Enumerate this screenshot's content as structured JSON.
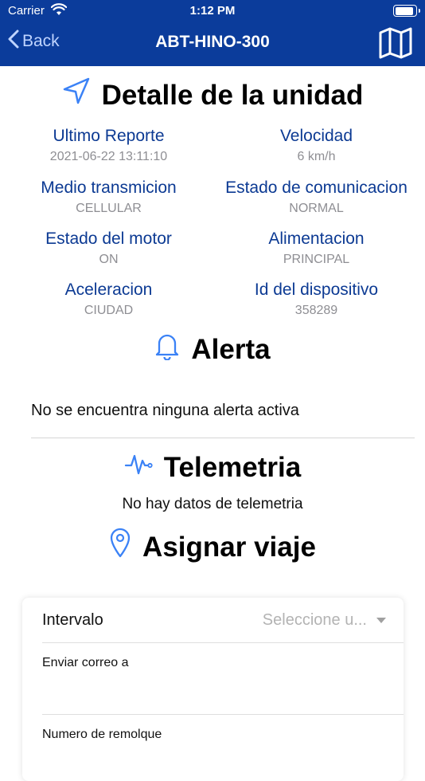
{
  "status_bar": {
    "carrier": "Carrier",
    "time": "1:12 PM"
  },
  "nav": {
    "back_label": "Back",
    "title": "ABT-HINO-300",
    "map_icon": "map-icon"
  },
  "detail": {
    "title": "Detalle de la unidad",
    "icon": "navigation-arrow-icon",
    "items": [
      {
        "label": "Ultimo Reporte",
        "value": "2021-06-22 13:11:10"
      },
      {
        "label": "Velocidad",
        "value": "6 km/h"
      },
      {
        "label": "Medio transmicion",
        "value": "CELLULAR"
      },
      {
        "label": "Estado de comunicacion",
        "value": "NORMAL"
      },
      {
        "label": "Estado del motor",
        "value": "ON"
      },
      {
        "label": "Alimentacion",
        "value": "PRINCIPAL"
      },
      {
        "label": "Aceleracion",
        "value": "CIUDAD"
      },
      {
        "label": "Id del dispositivo",
        "value": "358289"
      }
    ]
  },
  "alert": {
    "title": "Alerta",
    "icon": "bell-icon",
    "message": "No se encuentra ninguna alerta activa"
  },
  "telemetry": {
    "title": "Telemetria",
    "icon": "activity-pulse-icon",
    "message": "No hay datos de telemetria"
  },
  "trip": {
    "title": "Asignar viaje",
    "icon": "location-pin-icon",
    "interval_label": "Intervalo",
    "interval_placeholder": "Seleccione u...",
    "email_label": "Enviar correo a",
    "trailer_label": "Numero de remolque"
  },
  "colors": {
    "nav_bar": "#0b3c9b",
    "label_blue": "#0c3a93",
    "icon_blue": "#3b82f6",
    "value_gray": "#8e8e93"
  }
}
